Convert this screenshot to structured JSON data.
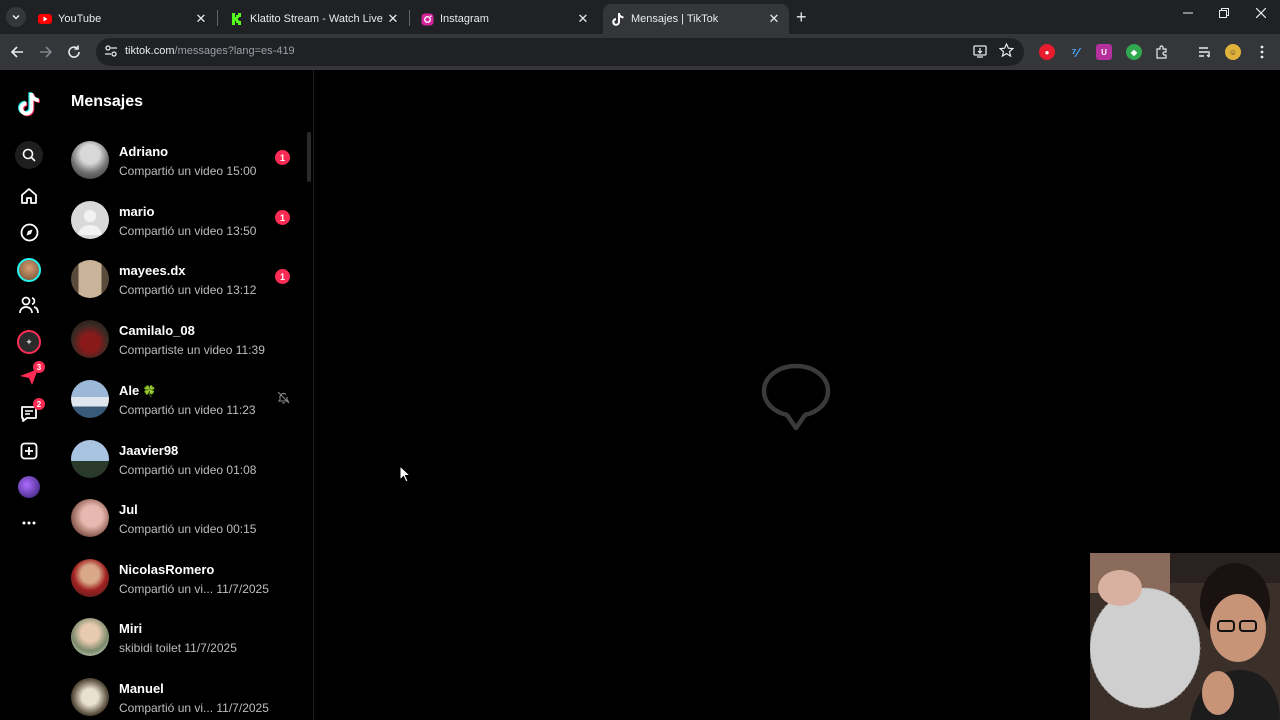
{
  "browser": {
    "tabs": [
      {
        "title": "YouTube",
        "favicon": "youtube-icon",
        "active": false
      },
      {
        "title": "Klatito Stream - Watch Live on",
        "favicon": "kick-icon",
        "active": false
      },
      {
        "title": "Instagram",
        "favicon": "instagram-icon",
        "active": false
      },
      {
        "title": "Mensajes | TikTok",
        "favicon": "tiktok-icon",
        "active": true
      }
    ],
    "url_host": "tiktok.com",
    "url_path": "/messages?lang=es-419"
  },
  "nav": {
    "inbox_badge": "3",
    "messages_badge": "2"
  },
  "messages": {
    "title": "Mensajes",
    "conversations": [
      {
        "name": "Adriano",
        "preview": "Compartió un video",
        "time": "15:00",
        "unread": "1"
      },
      {
        "name": "mario",
        "preview": "Compartió un video",
        "time": "13:50",
        "unread": "1"
      },
      {
        "name": "mayees.dx",
        "preview": "Compartió un video",
        "time": "13:12",
        "unread": "1"
      },
      {
        "name": "Camilalo_08",
        "preview": "Compartiste un video",
        "time": "11:39"
      },
      {
        "name": "Ale",
        "emoji": "🍀",
        "preview": "Compartió un video",
        "time": "11:23",
        "muted": true
      },
      {
        "name": "Jaavier98",
        "preview": "Compartió un video",
        "time": "01:08"
      },
      {
        "name": "Jul",
        "preview": "Compartió un video",
        "time": "00:15"
      },
      {
        "name": "NicolasRomero",
        "preview": "Compartió un vi...",
        "time": "11/7/2025"
      },
      {
        "name": "Miri",
        "preview": "skibidi toilet",
        "time": "11/7/2025"
      },
      {
        "name": "Manuel",
        "preview": "Compartió un vi...",
        "time": "11/7/2025"
      }
    ]
  },
  "colors": {
    "accent": "#fe2c55",
    "background": "#000000"
  }
}
